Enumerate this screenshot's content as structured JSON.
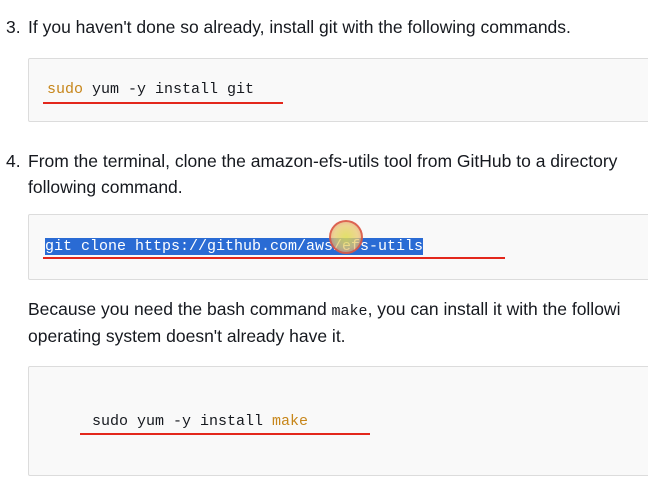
{
  "step3": {
    "number": "3.",
    "text": "If you haven't done so already, install git with the following commands.",
    "code": {
      "cmd": "sudo",
      "rest": " yum -y install git"
    }
  },
  "step4": {
    "number": "4.",
    "text_line1": "From the terminal, clone the amazon-efs-utils tool from GitHub to a directory",
    "text_line2": "following command.",
    "code": "git clone https://github.com/aws/efs-utils"
  },
  "make_note": {
    "line1_before": "Because you need the bash command ",
    "line1_code": "make",
    "line1_after": ", you can install it with the followi",
    "line2": "operating system doesn't already have it."
  },
  "make_code": {
    "prefix": "sudo yum -y install ",
    "pkg": "make"
  },
  "colors": {
    "keyword": "#c7861a",
    "selection": "#2a6bd4",
    "annotation_underline": "#e3271c",
    "code_background": "#f9f9f9"
  }
}
